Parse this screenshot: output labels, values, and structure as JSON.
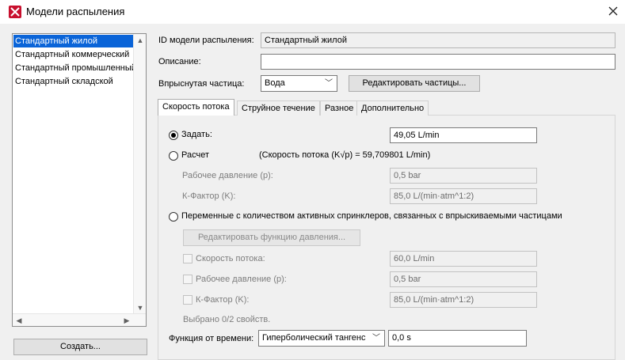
{
  "window": {
    "title": "Модели распыления"
  },
  "list": {
    "items": [
      {
        "label": "Стандартный жилой",
        "selected": true
      },
      {
        "label": "Стандартный коммерческий",
        "selected": false
      },
      {
        "label": "Стандартный промышленный",
        "selected": false
      },
      {
        "label": "Стандартный складской",
        "selected": false
      }
    ],
    "create_button": "Создать..."
  },
  "form": {
    "id_label": "ID модели распыления:",
    "id_value": "Стандартный жилой",
    "desc_label": "Описание:",
    "desc_value": "",
    "particle_label": "Впрыснутая частица:",
    "particle_value": "Вода",
    "edit_particles_button": "Редактировать частицы..."
  },
  "tabs": [
    {
      "label": "Скорость потока",
      "active": true
    },
    {
      "label": "Струйное течение",
      "active": false
    },
    {
      "label": "Разное",
      "active": false
    },
    {
      "label": "Дополнительно",
      "active": false
    }
  ],
  "flow": {
    "specify_label": "Задать:",
    "specify_value": "49,05 L/min",
    "calc_label": "Расчет",
    "calc_formula": "(Скорость потока (K√p) = 59,709801 L/min)",
    "pressure_label": "Рабочее давление (p):",
    "pressure_value": "0,5 bar",
    "kfactor_label": "К-Фактор (K):",
    "kfactor_value": "85,0 L/(min·atm^1:2)",
    "variable_label": "Переменные с количеством активных спринклеров, связанных с впрыскиваемыми частицами",
    "edit_pressure_button": "Редактировать функцию давления...",
    "cb_flow_label": "Скорость потока:",
    "cb_flow_value": "60,0 L/min",
    "cb_pressure_label": "Рабочее давление (p):",
    "cb_pressure_value": "0,5 bar",
    "cb_kfactor_label": "К-Фактор (K):",
    "cb_kfactor_value": "85,0 L/(min·atm^1:2)",
    "selected_count": "Выбрано 0/2 свойств.",
    "time_func_label": "Функция от времени:",
    "time_func_value": "Гиперболический тангенс",
    "time_value": "0,0 s"
  }
}
